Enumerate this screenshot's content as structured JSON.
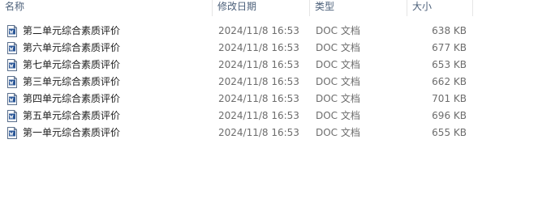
{
  "columns": {
    "name": "名称",
    "date": "修改日期",
    "type": "类型",
    "size": "大小"
  },
  "files": [
    {
      "name": "第二单元综合素质评价",
      "date": "2024/11/8 16:53",
      "type": "DOC 文档",
      "size": "638 KB",
      "icon": "word-doc-icon"
    },
    {
      "name": "第六单元综合素质评价",
      "date": "2024/11/8 16:53",
      "type": "DOC 文档",
      "size": "677 KB",
      "icon": "word-doc-icon"
    },
    {
      "name": "第七单元综合素质评价",
      "date": "2024/11/8 16:53",
      "type": "DOC 文档",
      "size": "653 KB",
      "icon": "word-doc-icon"
    },
    {
      "name": "第三单元综合素质评价",
      "date": "2024/11/8 16:53",
      "type": "DOC 文档",
      "size": "662 KB",
      "icon": "word-doc-icon"
    },
    {
      "name": "第四单元综合素质评价",
      "date": "2024/11/8 16:53",
      "type": "DOC 文档",
      "size": "701 KB",
      "icon": "word-doc-icon"
    },
    {
      "name": "第五单元综合素质评价",
      "date": "2024/11/8 16:53",
      "type": "DOC 文档",
      "size": "696 KB",
      "icon": "word-doc-icon"
    },
    {
      "name": "第一单元综合素质评价",
      "date": "2024/11/8 16:53",
      "type": "DOC 文档",
      "size": "655 KB",
      "icon": "word-doc-icon"
    }
  ],
  "colors": {
    "header_text": "#4c607a",
    "name_text": "#1e1e1e",
    "meta_text": "#6d6d6d",
    "icon_blue": "#2b5797"
  }
}
